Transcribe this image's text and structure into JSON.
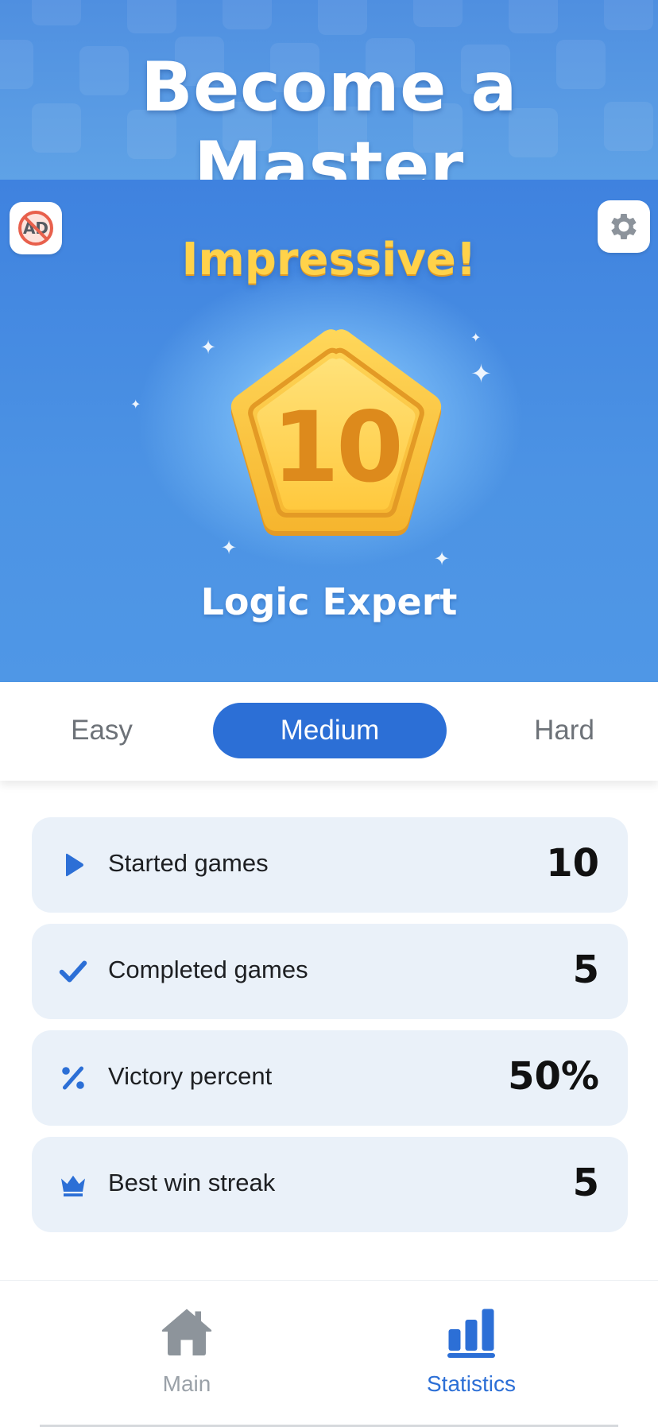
{
  "banner": {
    "title": "Become a Master"
  },
  "hero": {
    "ad_label": "AD",
    "heading": "Impressive!",
    "badge_level": "10",
    "badge_title": "Logic Expert",
    "colors": {
      "badge_gold": "#ffc83a",
      "badge_number": "#dd8a1c",
      "heading": "#ffd24a"
    }
  },
  "tabs": {
    "easy": "Easy",
    "medium": "Medium",
    "hard": "Hard",
    "selected": "Medium",
    "accent": "#2c6fd6"
  },
  "stats": [
    {
      "icon": "play-icon",
      "label": "Started games",
      "value": "10"
    },
    {
      "icon": "check-icon",
      "label": "Completed games",
      "value": "5"
    },
    {
      "icon": "percent-icon",
      "label": "Victory percent",
      "value": "50%"
    },
    {
      "icon": "crown-icon",
      "label": "Best win streak",
      "value": "5"
    }
  ],
  "nav": {
    "main": "Main",
    "statistics": "Statistics",
    "active": "Statistics"
  }
}
